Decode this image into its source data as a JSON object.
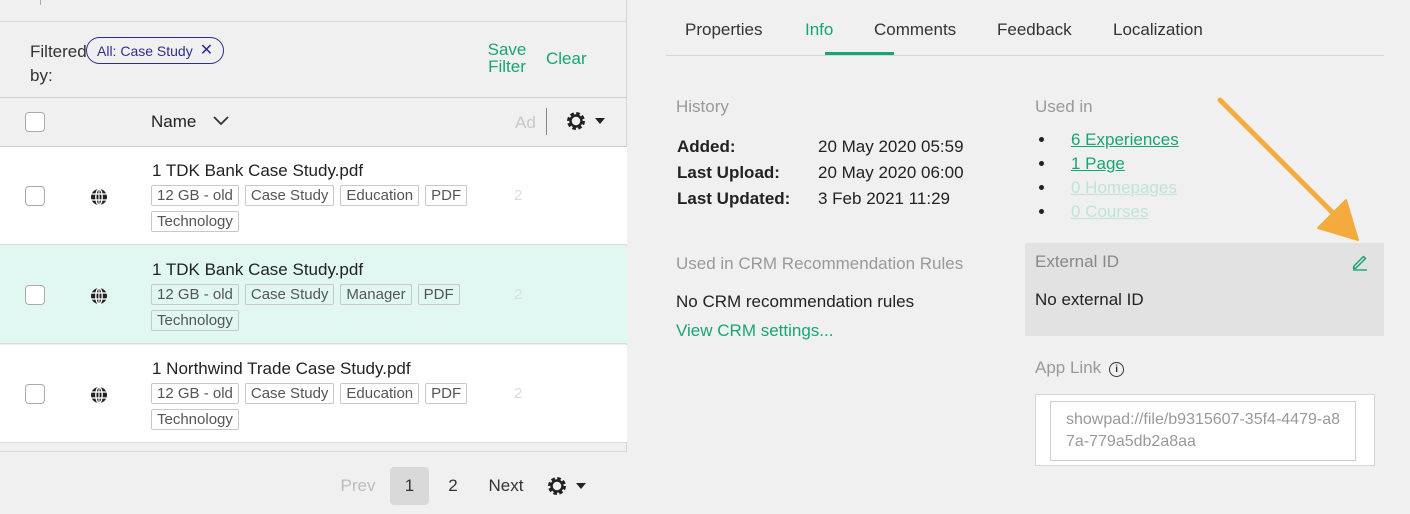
{
  "filter": {
    "filtered_by_label": "Filtered by:",
    "chip_label": "All: Case Study",
    "chip_remove": "✕",
    "save_filter": "Save Filter",
    "clear": "Clear"
  },
  "table": {
    "name_header": "Name",
    "added_header_partial": "Ad",
    "rows": [
      {
        "name": "1 TDK Bank Case Study.pdf",
        "tags": [
          "12 GB - old",
          "Case Study",
          "Education",
          "PDF",
          "Technology"
        ],
        "selected": false
      },
      {
        "name": "1 TDK Bank Case Study.pdf",
        "tags": [
          "12 GB - old",
          "Case Study",
          "Manager",
          "PDF",
          "Technology"
        ],
        "selected": true
      },
      {
        "name": "1 Northwind Trade Case Study.pdf",
        "tags": [
          "12 GB - old",
          "Case Study",
          "Education",
          "PDF",
          "Technology"
        ],
        "selected": false
      }
    ]
  },
  "pagination": {
    "prev": "Prev",
    "page1": "1",
    "page2": "2",
    "next": "Next"
  },
  "tabs": [
    "Properties",
    "Info",
    "Comments",
    "Feedback",
    "Localization"
  ],
  "active_tab": "Info",
  "history": {
    "title": "History",
    "added_label": "Added:",
    "added_value": "20 May 2020 05:59",
    "upload_label": "Last Upload:",
    "upload_value": "20 May 2020 06:00",
    "updated_label": "Last Updated:",
    "updated_value": "3 Feb 2021 11:29"
  },
  "used_in": {
    "title": "Used in",
    "items": [
      "6 Experiences",
      "1 Page",
      "0 Homepages",
      "0 Courses"
    ]
  },
  "crm": {
    "title": "Used in CRM Recommendation Rules",
    "value": "No CRM recommendation rules",
    "link": "View CRM settings..."
  },
  "external_id": {
    "title": "External ID",
    "value": "No external ID"
  },
  "app_link": {
    "title": "App Link",
    "value": "showpad://file/b9315607-35f4-4479-a87a-779a5db2a8aa"
  },
  "colors": {
    "accent": "#17a673",
    "selected_row": "#e0f8f1",
    "chip": "#2d2f8a",
    "arrow": "#f2ab3c"
  }
}
